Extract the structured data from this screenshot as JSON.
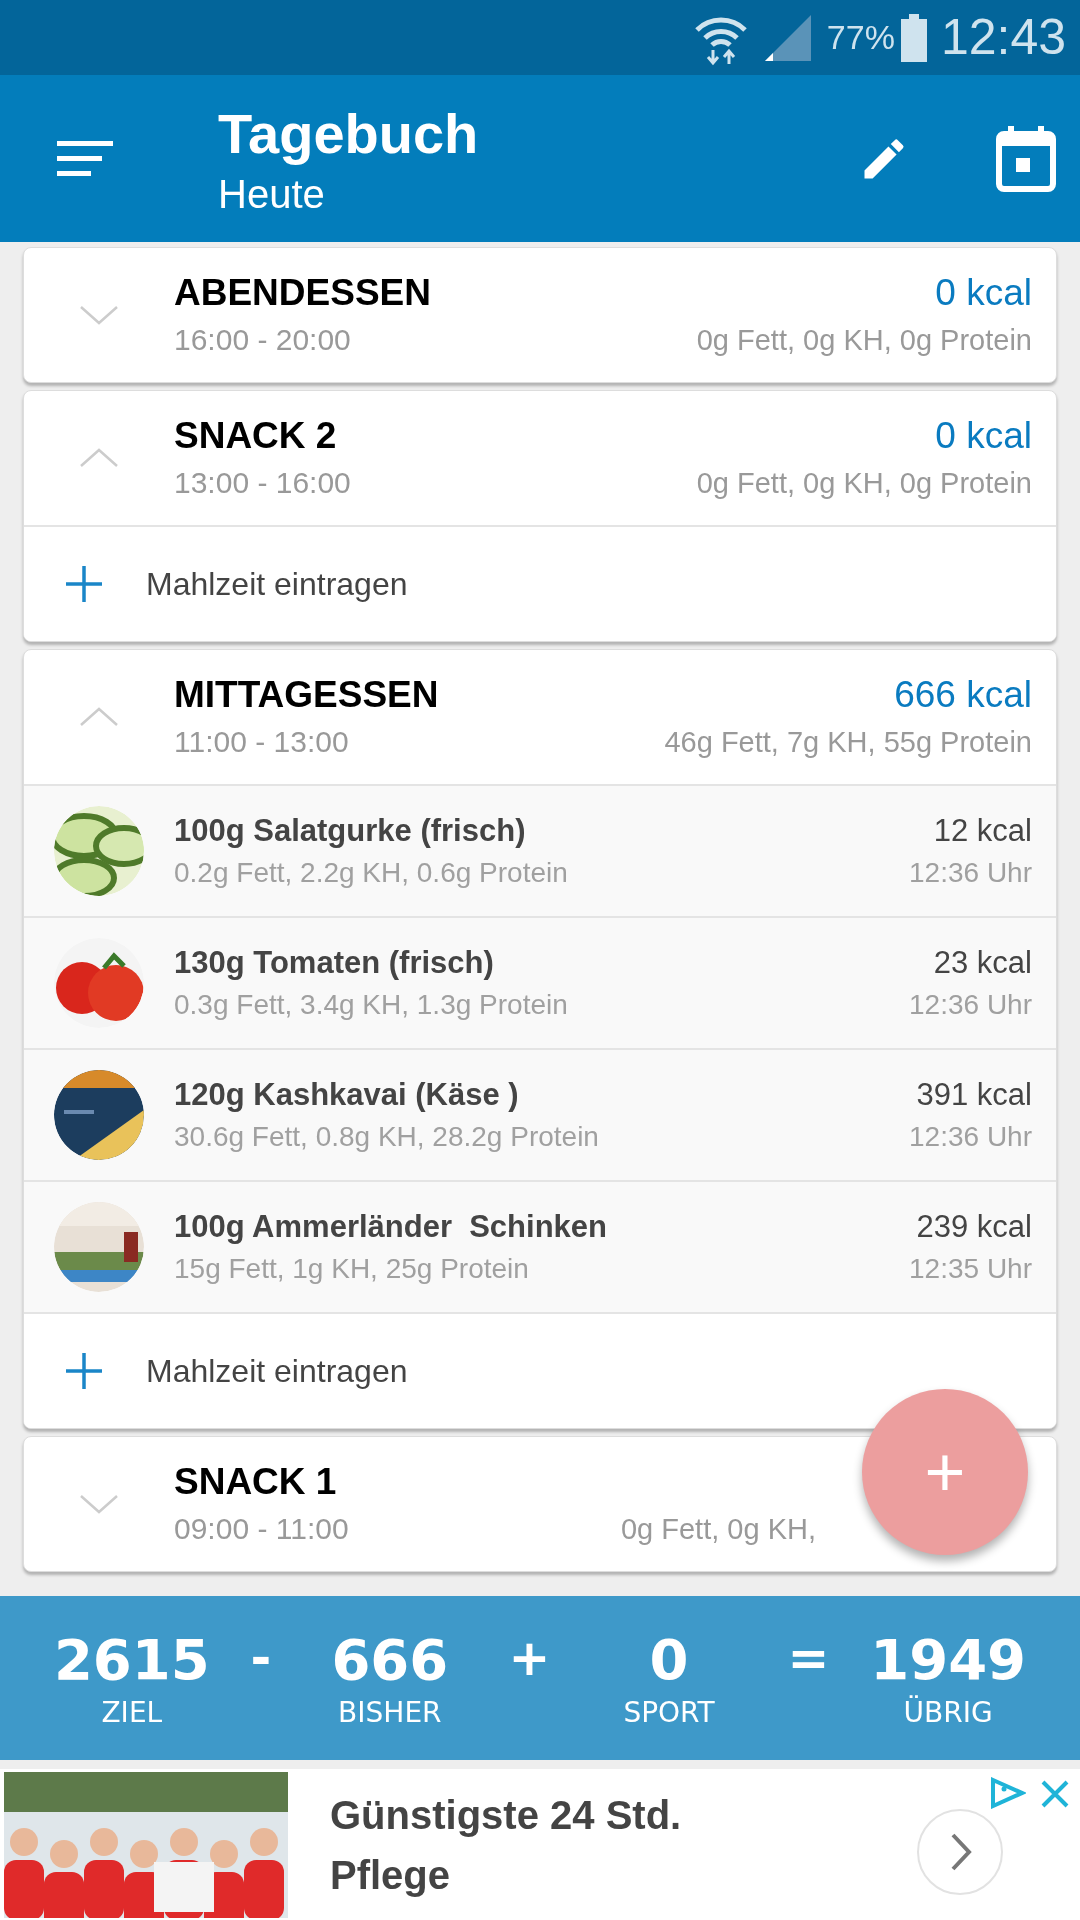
{
  "status_bar": {
    "battery": "77%",
    "time": "12:43"
  },
  "app_bar": {
    "title": "Tagebuch",
    "subtitle": "Heute"
  },
  "meals": [
    {
      "name": "ABENDESSEN",
      "time": "16:00 - 20:00",
      "kcal": "0 kcal",
      "macros": "0g Fett, 0g KH, 0g Protein",
      "expanded": false
    },
    {
      "name": "SNACK 2",
      "time": "13:00 - 16:00",
      "kcal": "0 kcal",
      "macros": "0g Fett, 0g KH, 0g Protein",
      "expanded": true,
      "add_label": "Mahlzeit eintragen"
    },
    {
      "name": "MITTAGESSEN",
      "time": "11:00 - 13:00",
      "kcal": "666 kcal",
      "macros": "46g Fett, 7g KH, 55g Protein",
      "expanded": true,
      "add_label": "Mahlzeit eintragen",
      "entries": [
        {
          "name": "100g Salatgurke (frisch)",
          "macros": "0.2g Fett, 2.2g KH, 0.6g Protein",
          "kcal": "12 kcal",
          "time": "12:36 Uhr"
        },
        {
          "name": "130g Tomaten (frisch)",
          "macros": "0.3g Fett, 3.4g KH, 1.3g Protein",
          "kcal": "23 kcal",
          "time": "12:36 Uhr"
        },
        {
          "name": "120g Kashkavai (Käse )",
          "macros": "30.6g Fett, 0.8g KH, 28.2g Protein",
          "kcal": "391 kcal",
          "time": "12:36 Uhr"
        },
        {
          "name": "100g Ammerländer  Schinken",
          "macros": "15g Fett, 1g KH, 25g Protein",
          "kcal": "239 kcal",
          "time": "12:35 Uhr"
        }
      ]
    },
    {
      "name": "SNACK 1",
      "time": "09:00 - 11:00",
      "macros": "0g Fett, 0g KH,",
      "expanded": false
    }
  ],
  "fab": {
    "label": "+"
  },
  "summary": {
    "terms": [
      {
        "value": "2615",
        "label": "ZIEL"
      },
      {
        "value": "666",
        "label": "BISHER"
      },
      {
        "value": "0",
        "label": "SPORT"
      },
      {
        "value": "1949",
        "label": "ÜBRIG"
      }
    ],
    "operators": [
      "-",
      "+",
      "="
    ]
  },
  "ad": {
    "headline": "Günstigste 24 Std. Pflege"
  }
}
